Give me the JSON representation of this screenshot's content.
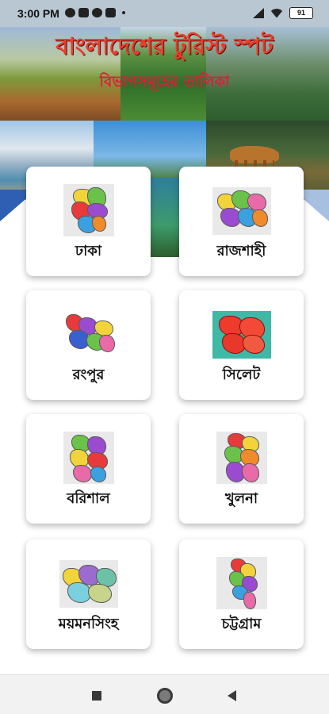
{
  "status_bar": {
    "time": "3:00 PM",
    "battery": "91",
    "icons_left": [
      "sync-icon",
      "youtube-icon",
      "circle-icon",
      "youtube-icon"
    ],
    "icons_right": [
      "signal-icon",
      "wifi-icon",
      "battery-icon"
    ]
  },
  "banner": {
    "title": "বাংলাদেশের টুরিস্ট স্পট",
    "subtitle": "বিভাগসমূহের তালিকা",
    "title_color": "#ef3b2a",
    "subtitle_color": "#e8183a"
  },
  "divisions": [
    {
      "label": "ঢাকা",
      "icon": "dhaka-map-icon"
    },
    {
      "label": "রাজশাহী",
      "icon": "rajshahi-map-icon"
    },
    {
      "label": "রংপুর",
      "icon": "rangpur-map-icon"
    },
    {
      "label": "সিলেট",
      "icon": "sylhet-map-icon"
    },
    {
      "label": "বরিশাল",
      "icon": "barishal-map-icon"
    },
    {
      "label": "খুলনা",
      "icon": "khulna-map-icon"
    },
    {
      "label": "ময়মনসিংহ",
      "icon": "mymensingh-map-icon"
    },
    {
      "label": "চট্টগ্রাম",
      "icon": "chattogram-map-icon"
    }
  ],
  "nav_bar": {
    "buttons": [
      "recent-apps-button",
      "home-button",
      "back-button"
    ]
  }
}
